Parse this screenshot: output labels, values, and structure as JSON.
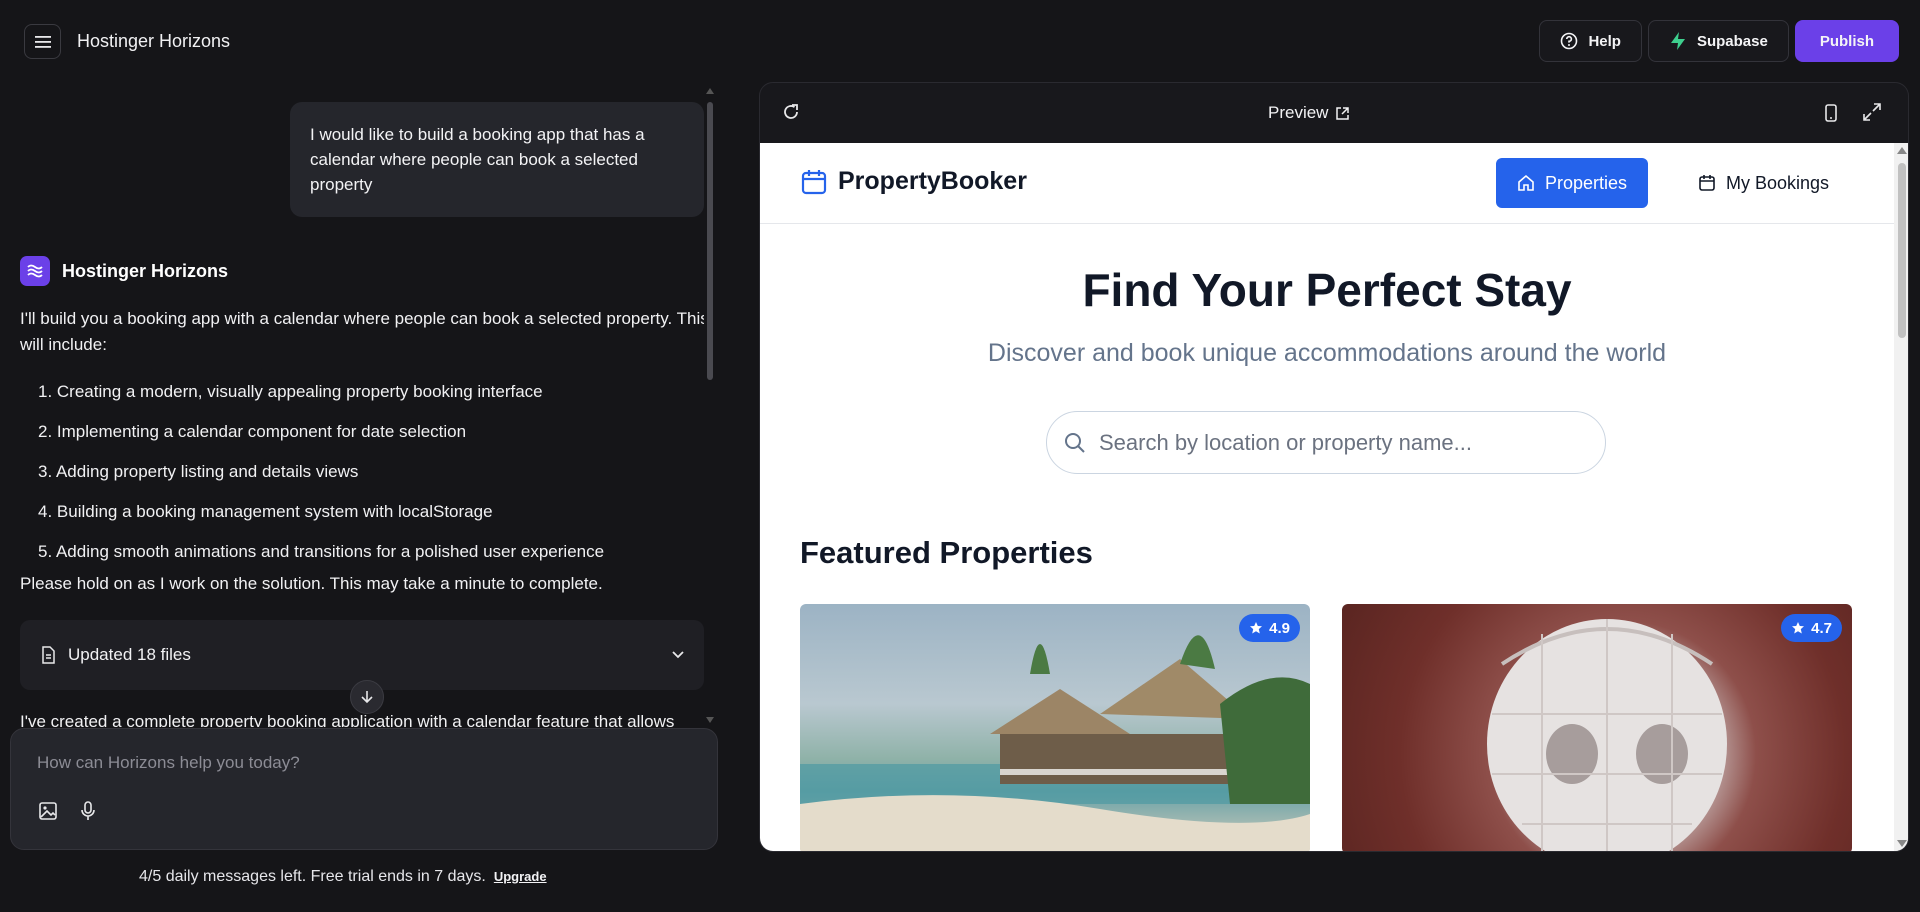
{
  "app": {
    "title": "Hostinger Horizons",
    "actions": {
      "help": "Help",
      "supabase": "Supabase",
      "publish": "Publish"
    }
  },
  "chat": {
    "user_message": "I would like to build a booking app that has a calendar where people can book a selected property",
    "ai_name": "Hostinger Horizons",
    "ai_intro": "I'll build you a booking app with a calendar where people can book a selected property. This will include:",
    "ai_steps": [
      "1. Creating a modern, visually appealing property booking interface",
      "2. Implementing a calendar component for date selection",
      "3. Adding property listing and details views",
      "4. Building a booking management system with localStorage",
      "5. Adding smooth animations and transitions for a polished user experience"
    ],
    "ai_hold": "Please hold on as I work on the solution. This may take a minute to complete.",
    "files_label": "Updated 18 files",
    "cut_text": "I've created a complete property booking application with a calendar feature that allows"
  },
  "composer": {
    "placeholder": "How can Horizons help you today?"
  },
  "footer": {
    "note": "4/5 daily messages left. Free trial ends in 7 days.",
    "upgrade": "Upgrade"
  },
  "preview": {
    "title": "Preview",
    "site": {
      "brand": "PropertyBooker",
      "nav_properties": "Properties",
      "nav_bookings": "My Bookings",
      "hero_title": "Find Your Perfect Stay",
      "hero_subtitle": "Discover and book unique accommodations around the world",
      "search_placeholder": "Search by location or property name...",
      "featured_title": "Featured Properties",
      "cards": [
        {
          "rating": "4.9"
        },
        {
          "rating": "4.7"
        }
      ]
    }
  }
}
